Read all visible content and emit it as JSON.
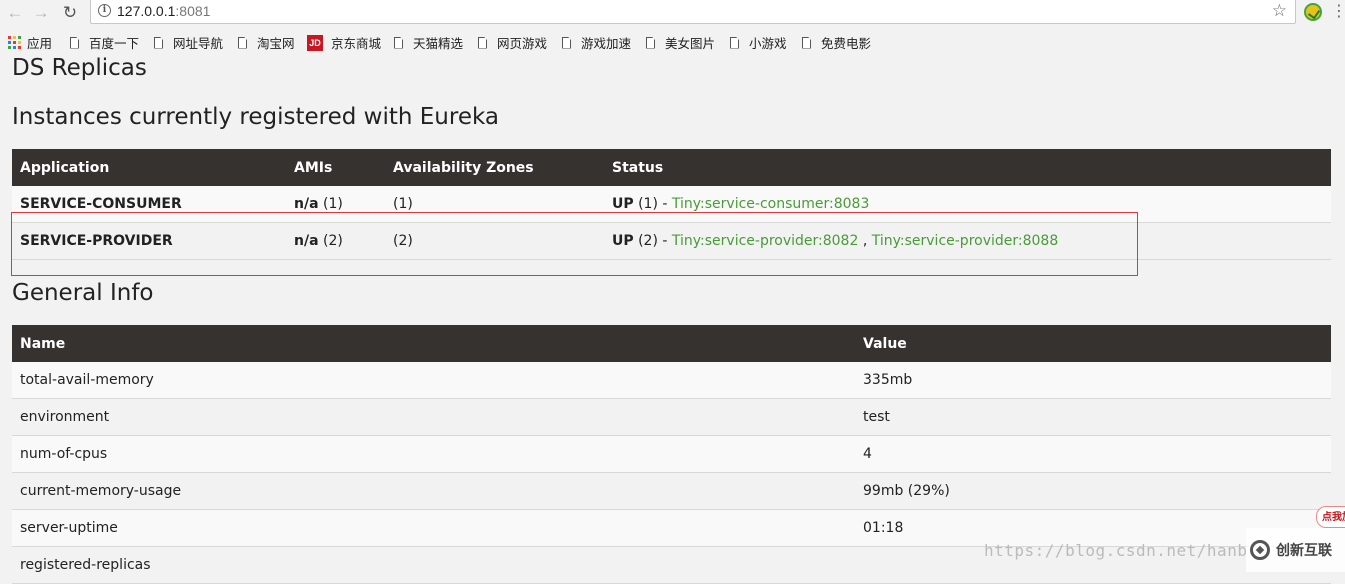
{
  "browser": {
    "url_host": "127.0.0.1",
    "url_port": ":8081",
    "bookmarks": [
      "应用",
      "百度一下",
      "网址导航",
      "淘宝网",
      "京东商城",
      "天猫精选",
      "网页游戏",
      "游戏加速",
      "美女图片",
      "小游戏",
      "免费电影"
    ],
    "jd_badge": "JD"
  },
  "page": {
    "title_ds": "DS Replicas",
    "title_instances": "Instances currently registered with Eureka",
    "title_general": "General Info"
  },
  "instances": {
    "headers": [
      "Application",
      "AMIs",
      "Availability Zones",
      "Status"
    ],
    "rows": [
      {
        "application": "SERVICE-CONSUMER",
        "amis_bold": "n/a",
        "amis_count": " (1)",
        "zones": "(1)",
        "status_bold": "UP",
        "status_count": " (1) - ",
        "links": [
          "Tiny:service-consumer:8083"
        ]
      },
      {
        "application": "SERVICE-PROVIDER",
        "amis_bold": "n/a",
        "amis_count": " (2)",
        "zones": "(2)",
        "status_bold": "UP",
        "status_count": " (2) - ",
        "links": [
          "Tiny:service-provider:8082",
          "Tiny:service-provider:8088"
        ],
        "link_sep": " , "
      }
    ]
  },
  "general": {
    "headers": [
      "Name",
      "Value"
    ],
    "rows": [
      {
        "name": "total-avail-memory",
        "value": "335mb"
      },
      {
        "name": "environment",
        "value": "test"
      },
      {
        "name": "num-of-cpus",
        "value": "4"
      },
      {
        "name": "current-memory-usage",
        "value": "99mb (29%)"
      },
      {
        "name": "server-uptime",
        "value": "01:18"
      },
      {
        "name": "registered-replicas",
        "value": ""
      }
    ]
  },
  "overlay": {
    "watermark": "https://blog.csdn.net/hanb",
    "logo_text": "创新互联",
    "float_badge": "点我加"
  },
  "colors": {
    "table_header": "#353230",
    "link": "#4a9a3a",
    "highlight_box": "#e0363c"
  }
}
